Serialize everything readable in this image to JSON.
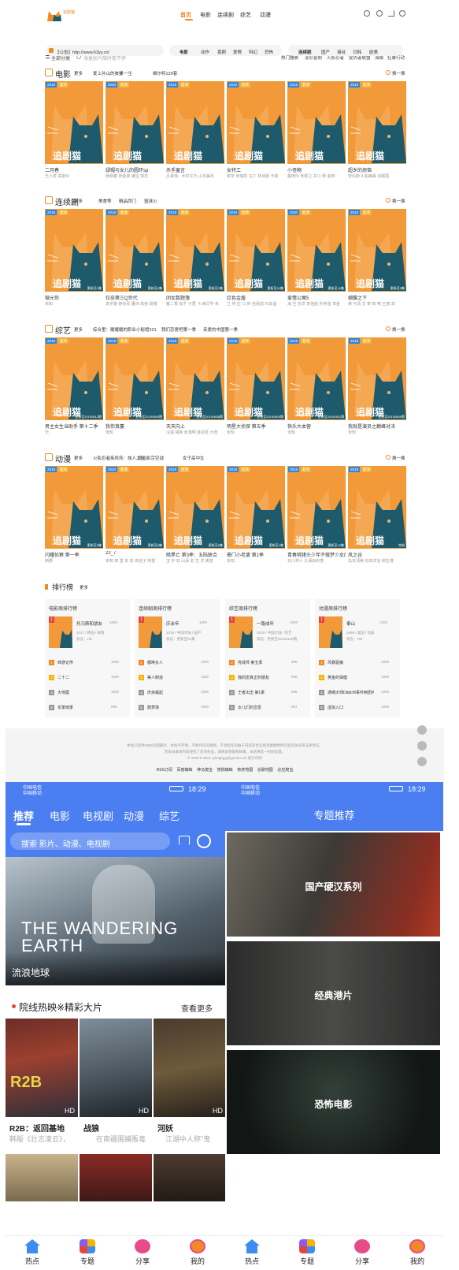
{
  "site": {
    "logo_text": "追剧猫",
    "nav": [
      "首页",
      "电影",
      "连续剧",
      "综艺",
      "动漫"
    ],
    "all_categories": "全部分类",
    "search_placeholder": "海量影片随时看不停",
    "hot_search_label": "热门搜索",
    "hot_tags": [
      "变形金刚",
      "火影忍者",
      "复仇者联盟",
      "海贼",
      "狂暴行动"
    ],
    "notice": "【公告】http://www.63yy.cn/",
    "movie_genre_label": "电影",
    "movie_genres": [
      "动作",
      "喜剧",
      "爱情",
      "科幻",
      "恐怖"
    ],
    "tv_label": "连续剧",
    "tv_regions": [
      "国产",
      "港台",
      "日韩",
      "欧美"
    ],
    "accent": "#f08a24"
  },
  "sections": [
    {
      "title": "电影",
      "more": "更多",
      "switch": "换一换",
      "tags": [
        "爱上孙山的女孩",
        "一步一生",
        "维尔特129巷"
      ],
      "cards": [
        {
          "year": "2019",
          "quality": "超清",
          "title": "二月春",
          "actors": "王小虎 郑金玲",
          "status": ""
        },
        {
          "year": "2020",
          "quality": "超清",
          "title": "绿帽与女儿的圆环sp",
          "actors": "杨佩春 张金柳 潘宝 郭志",
          "status": ""
        },
        {
          "year": "2019",
          "quality": "超清",
          "title": "杀手童言",
          "actors": "吕良伟 - 木村文乃 山本美月",
          "status": ""
        },
        {
          "year": "2019",
          "quality": "超清",
          "title": "女特工",
          "actors": "谢宇 张瑞哲 马丁 林诗晨 卡莉",
          "status": ""
        },
        {
          "year": "2019",
          "quality": "超清",
          "title": "小怪物",
          "actors": "藤田玲 朱颖之 井川 杨 金田",
          "status": ""
        },
        {
          "year": "2019",
          "quality": "超清",
          "title": "超乡的烦恼",
          "actors": "劳伦斯 A 帕蒂森 邓顺霞",
          "status": ""
        }
      ]
    },
    {
      "title": "连续剧",
      "more": "更多",
      "switch": "换一换",
      "tags": [
        "美食等",
        "精品西门",
        "篮球火"
      ],
      "cards": [
        {
          "year": "2019",
          "quality": "超清",
          "title": "微元你",
          "actors": "未知",
          "status": "更新至1集"
        },
        {
          "year": "2019",
          "quality": "超清",
          "title": "拉奈第三Q世代",
          "actors": "高宇路 钟怡青 董诗 高裕 胡博",
          "status": "更新至6集"
        },
        {
          "year": "2019",
          "quality": "超清",
          "title": "闭女数题簿",
          "actors": "戴二香 加千 子君 飞 西贝学 朱",
          "status": "更新至1集"
        },
        {
          "year": "2019",
          "quality": "超清",
          "title": "红色金盾",
          "actors": "兰 何 庄 口 钟 自组成 石如温",
          "status": "更新至24集"
        },
        {
          "year": "2020",
          "quality": "超清",
          "title": "爱情公寓5",
          "actors": "海 旦 苏洋 李佳航 孙彦强 李金",
          "status": "更新至16集"
        },
        {
          "year": "2019",
          "quality": "超清",
          "title": "蝴蝶之下",
          "actors": "黄 可清 艾 奇 知 鸭 王丽 高",
          "status": "更新至5集"
        }
      ]
    },
    {
      "title": "综艺",
      "more": "更多",
      "switch": "换一换",
      "tags": [
        "综合里：暖暖暖的职业小秘馆221",
        "我们恋爱吧第一季",
        "亲爱的中国第一季"
      ],
      "cards": [
        {
          "year": "2019",
          "quality": "超清",
          "title": "男主女生当助手 第十二季",
          "actors": "无",
          "status": "更新至20190813期"
        },
        {
          "year": "2019",
          "quality": "超清",
          "title": "我你真蔓",
          "actors": "未知",
          "status": "更新至20190809期"
        },
        {
          "year": "2019",
          "quality": "超清",
          "title": "天天向上",
          "actors": "汪涵 钱枫 俞灏明 金恩圣 大张",
          "status": "更新至20190808期"
        },
        {
          "year": "2019",
          "quality": "超清",
          "title": "明星大侦探 第五季",
          "actors": "未知",
          "status": "更新至20190809期"
        },
        {
          "year": "2019",
          "quality": "超清",
          "title": "快乐大本营",
          "actors": "未知",
          "status": "更新至20190811期"
        },
        {
          "year": "2019",
          "quality": "超清",
          "title": "我就是演员之巅峰对决",
          "actors": "未知",
          "status": "更新至20190809期"
        }
      ]
    },
    {
      "title": "动漫",
      "more": "更多",
      "switch": "换一换",
      "tags": [
        "火影忍者疾风传：烛人之死",
        "叔治影宗空战",
        "女子高中生"
      ],
      "cards": [
        {
          "year": "2019",
          "quality": "超清",
          "title": "闪耀侦察 第一季",
          "actors": "西野",
          "status": "更新至6集"
        },
        {
          "year": "2020",
          "quality": "超清",
          "title": "22_7",
          "actors": "未知 田 雪 本 泉 田佳子 阿部",
          "status": "更新至5集"
        },
        {
          "year": "2019",
          "quality": "超清",
          "title": "暗黑亡 第3季：五陆联合",
          "actors": "玉 宇 石 山添 宏 芝 洋 奥富",
          "status": "更新至6集"
        },
        {
          "year": "2019",
          "quality": "超清",
          "title": "豪门小老婆 第1季",
          "actors": "未知",
          "status": "更新至1集"
        },
        {
          "year": "2019",
          "quality": "超清",
          "title": "青春桃猪头少年不做梦少女的梦",
          "actors": "石川界人 久保由利香",
          "status": "更新至13集"
        },
        {
          "year": "2019",
          "quality": "超清",
          "title": "风之谷",
          "actors": "岛本须美 松田洋治 柳生博",
          "status": "完结"
        }
      ]
    }
  ],
  "rankings": {
    "title": "排行榜",
    "more": "更多",
    "boxes": [
      {
        "head": "电影周排行榜",
        "top": "托马斯和朋友",
        "top_meta": [
          "2017 / 韩国 / 剧情",
          "状态：HD"
        ],
        "top_hits": "1000",
        "rows": [
          {
            "n": "2",
            "name": "西游记传",
            "hits": "1000"
          },
          {
            "n": "3",
            "name": "二十二",
            "hits": "1000"
          },
          {
            "n": "4",
            "name": "大地震",
            "hits": "1000"
          },
          {
            "n": "5",
            "name": "花季雨季",
            "hits": "999"
          }
        ]
      },
      {
        "head": "连续剧周排行榜",
        "top": "庆余年",
        "top_meta": [
          "2019 / 中国大陆 / 国产",
          "状态：更新至31集"
        ],
        "top_hits": "1000",
        "rows": [
          {
            "n": "2",
            "name": "都唤女人",
            "hits": "1000"
          },
          {
            "n": "3",
            "name": "美人制造",
            "hits": "1000"
          },
          {
            "n": "4",
            "name": "庆余崛起",
            "hits": "1000"
          },
          {
            "n": "5",
            "name": "鼓梦境",
            "hits": "1000"
          }
        ]
      },
      {
        "head": "综艺周排行榜",
        "top": "一路成年",
        "top_meta": [
          "2019 / 中国大陆 / 综艺",
          "状态：更新至20191128期"
        ],
        "top_hits": "1000",
        "rows": [
          {
            "n": "2",
            "name": "亮成师 第五季",
            "hits": "999"
          },
          {
            "n": "3",
            "name": "我的愿真正的朋友",
            "hits": "996"
          },
          {
            "n": "4",
            "name": "王者出击 第1季",
            "hits": "998"
          },
          {
            "n": "5",
            "name": "女儿们的恋爱",
            "hits": "997"
          }
        ]
      },
      {
        "head": "动漫周排行榜",
        "top": "泰山",
        "top_meta": [
          "1999 / 美国 / 动画",
          "状态：HD"
        ],
        "top_hits": "1000",
        "rows": [
          {
            "n": "2",
            "name": "风暴驱魔",
            "hits": "1000"
          },
          {
            "n": "3",
            "name": "黄金的保健",
            "hits": "1000"
          },
          {
            "n": "4",
            "name": "通缉大师DddcM事件两团Wiki",
            "hits": "1000"
          },
          {
            "n": "5",
            "name": "虚拟入口",
            "hits": "1000"
          }
        ]
      }
    ],
    "rank_colors": [
      "#e8443a",
      "#f08a24",
      "#f5b400",
      "#999",
      "#999"
    ]
  },
  "footer": {
    "line1": "本站只提供WEB页面服务，本站不存储、不制作任何视频，不承担任何由于内容的合法性及健康性所引起的争议和法律责任。",
    "line2": "若本站收录内容侵犯了您的权益，请附说明联系邮箱，本站将第一时间处理。",
    "line3": "© 2020  E-Mail: qianghgyj@gmail.com  统计代码",
    "links": [
      "RSS订阅",
      "百度蜘蛛",
      "神马爬虫",
      "搜狗蜘蛛",
      "奇虎地图",
      "谷歌地图",
      "必应爬虫"
    ]
  },
  "phone_left": {
    "carrier": "中国电信",
    "carrier2": "中国移动",
    "time": "18:29",
    "tabs": [
      "推荐",
      "电影",
      "电视剧",
      "动漫",
      "综艺"
    ],
    "search_placeholder": "搜索 影片、动漫、电视剧",
    "hero_title": "流浪地球",
    "hero_poster_text": "THE WANDERING EARTH",
    "section_title": "院线热映※精彩大片",
    "section_more": "查看更多",
    "movies": [
      {
        "title": "R2B：返回基地",
        "desc": "韩版《壮志凌云》，",
        "badge": "HD"
      },
      {
        "title": "战狼",
        "desc": "在南疆围捕贩毒",
        "badge": "HD"
      },
      {
        "title": "河妖",
        "desc": "江湖中人称\"鬼",
        "badge": "HD"
      }
    ],
    "bottom_nav": [
      "热点",
      "专题",
      "分享",
      "我的"
    ]
  },
  "phone_right": {
    "carrier": "中国电信",
    "carrier2": "中国移动",
    "time": "18:29",
    "title": "专题推荐",
    "topics": [
      "国产硬汉系列",
      "经典港片",
      "恐怖电影"
    ],
    "bottom_nav": [
      "热点",
      "专题",
      "分享",
      "我的"
    ]
  }
}
